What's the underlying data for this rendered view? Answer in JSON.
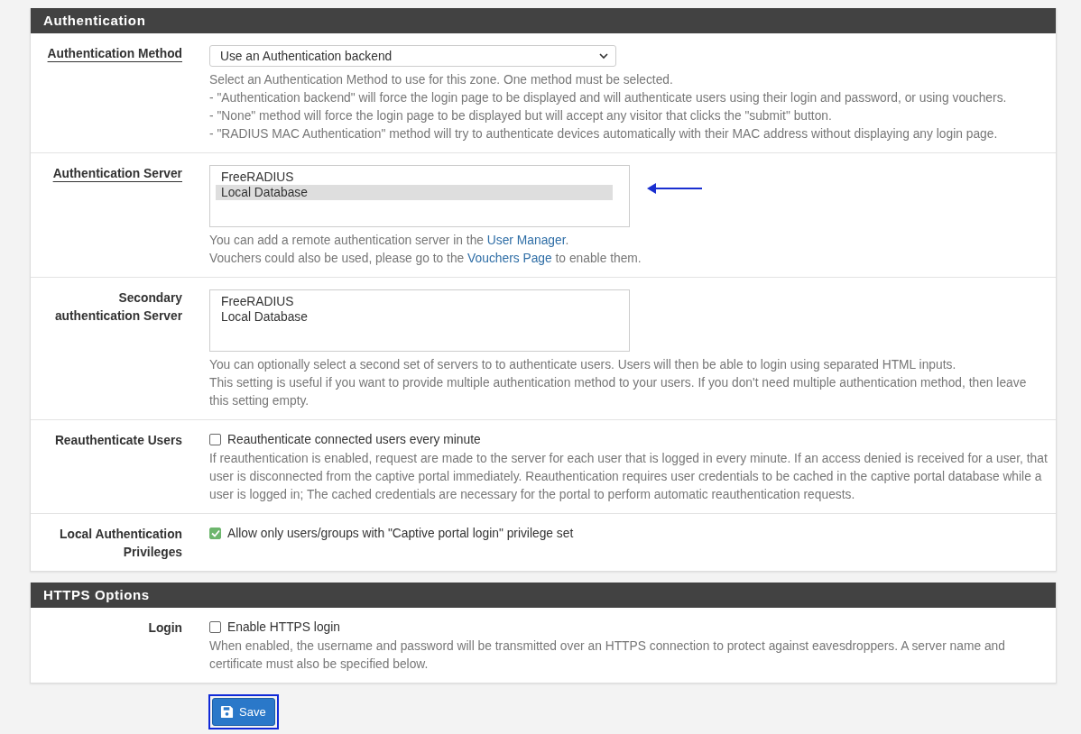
{
  "panels": [
    {
      "title": "Authentication",
      "rows": [
        {
          "kind": "select",
          "label": "Authentication Method",
          "label_link": true,
          "value": "Use an Authentication backend",
          "help": [
            [
              {
                "text": "Select an Authentication Method to use for this zone. One method must be selected.",
                "link": false
              }
            ],
            [
              {
                "text": "- \"Authentication backend\" will force the login page to be displayed and will authenticate users using their login and password, or using vouchers.",
                "link": false
              }
            ],
            [
              {
                "text": "- \"None\" method will force the login page to be displayed but will accept any visitor that clicks the \"submit\" button.",
                "link": false
              }
            ],
            [
              {
                "text": "- \"RADIUS MAC Authentication\" method will try to authenticate devices automatically with their MAC address without displaying any login page.",
                "link": false
              }
            ]
          ]
        },
        {
          "kind": "listbox",
          "label": "Authentication Server",
          "label_link": true,
          "pointer_arrow": true,
          "options": [
            {
              "text": "FreeRADIUS",
              "selected": false
            },
            {
              "text": "Local Database",
              "selected": true
            }
          ],
          "help": [
            [
              {
                "text": "You can add a remote authentication server in the ",
                "link": false
              },
              {
                "text": "User Manager",
                "link": true
              },
              {
                "text": ".",
                "link": false
              }
            ],
            [
              {
                "text": "Vouchers could also be used, please go to the ",
                "link": false
              },
              {
                "text": "Vouchers Page",
                "link": true
              },
              {
                "text": " to enable them.",
                "link": false
              }
            ]
          ]
        },
        {
          "kind": "listbox",
          "label": "Secondary authentication Server",
          "label_link": false,
          "pointer_arrow": false,
          "options": [
            {
              "text": "FreeRADIUS",
              "selected": false
            },
            {
              "text": "Local Database",
              "selected": false
            }
          ],
          "help": [
            [
              {
                "text": "You can optionally select a second set of servers to to authenticate users. Users will then be able to login using separated HTML inputs.",
                "link": false
              }
            ],
            [
              {
                "text": "This setting is useful if you want to provide multiple authentication method to your users. If you don't need multiple authentication method, then leave this setting empty.",
                "link": false
              }
            ]
          ]
        },
        {
          "kind": "checkbox",
          "label": "Reauthenticate Users",
          "label_link": false,
          "checked": false,
          "caption": "Reauthenticate connected users every minute",
          "help": [
            [
              {
                "text": "If reauthentication is enabled, request are made to the server for each user that is logged in every minute. If an access denied is received for a user, that user is disconnected from the captive portal immediately. Reauthentication requires user credentials to be cached in the captive portal database while a user is logged in; The cached credentials are necessary for the portal to perform automatic reauthentication requests.",
                "link": false
              }
            ]
          ]
        },
        {
          "kind": "checkbox",
          "label": "Local Authentication Privileges",
          "label_link": false,
          "checked": true,
          "caption": "Allow only users/groups with \"Captive portal login\" privilege set",
          "help": []
        }
      ]
    },
    {
      "title": "HTTPS Options",
      "rows": [
        {
          "kind": "checkbox",
          "label": "Login",
          "label_link": false,
          "checked": false,
          "caption": "Enable HTTPS login",
          "help": [
            [
              {
                "text": "When enabled, the username and password will be transmitted over an HTTPS connection to protect against eavesdroppers. A server name and certificate must also be specified below.",
                "link": false
              }
            ]
          ]
        }
      ]
    }
  ],
  "save_button": {
    "label": "Save",
    "focused": true
  }
}
